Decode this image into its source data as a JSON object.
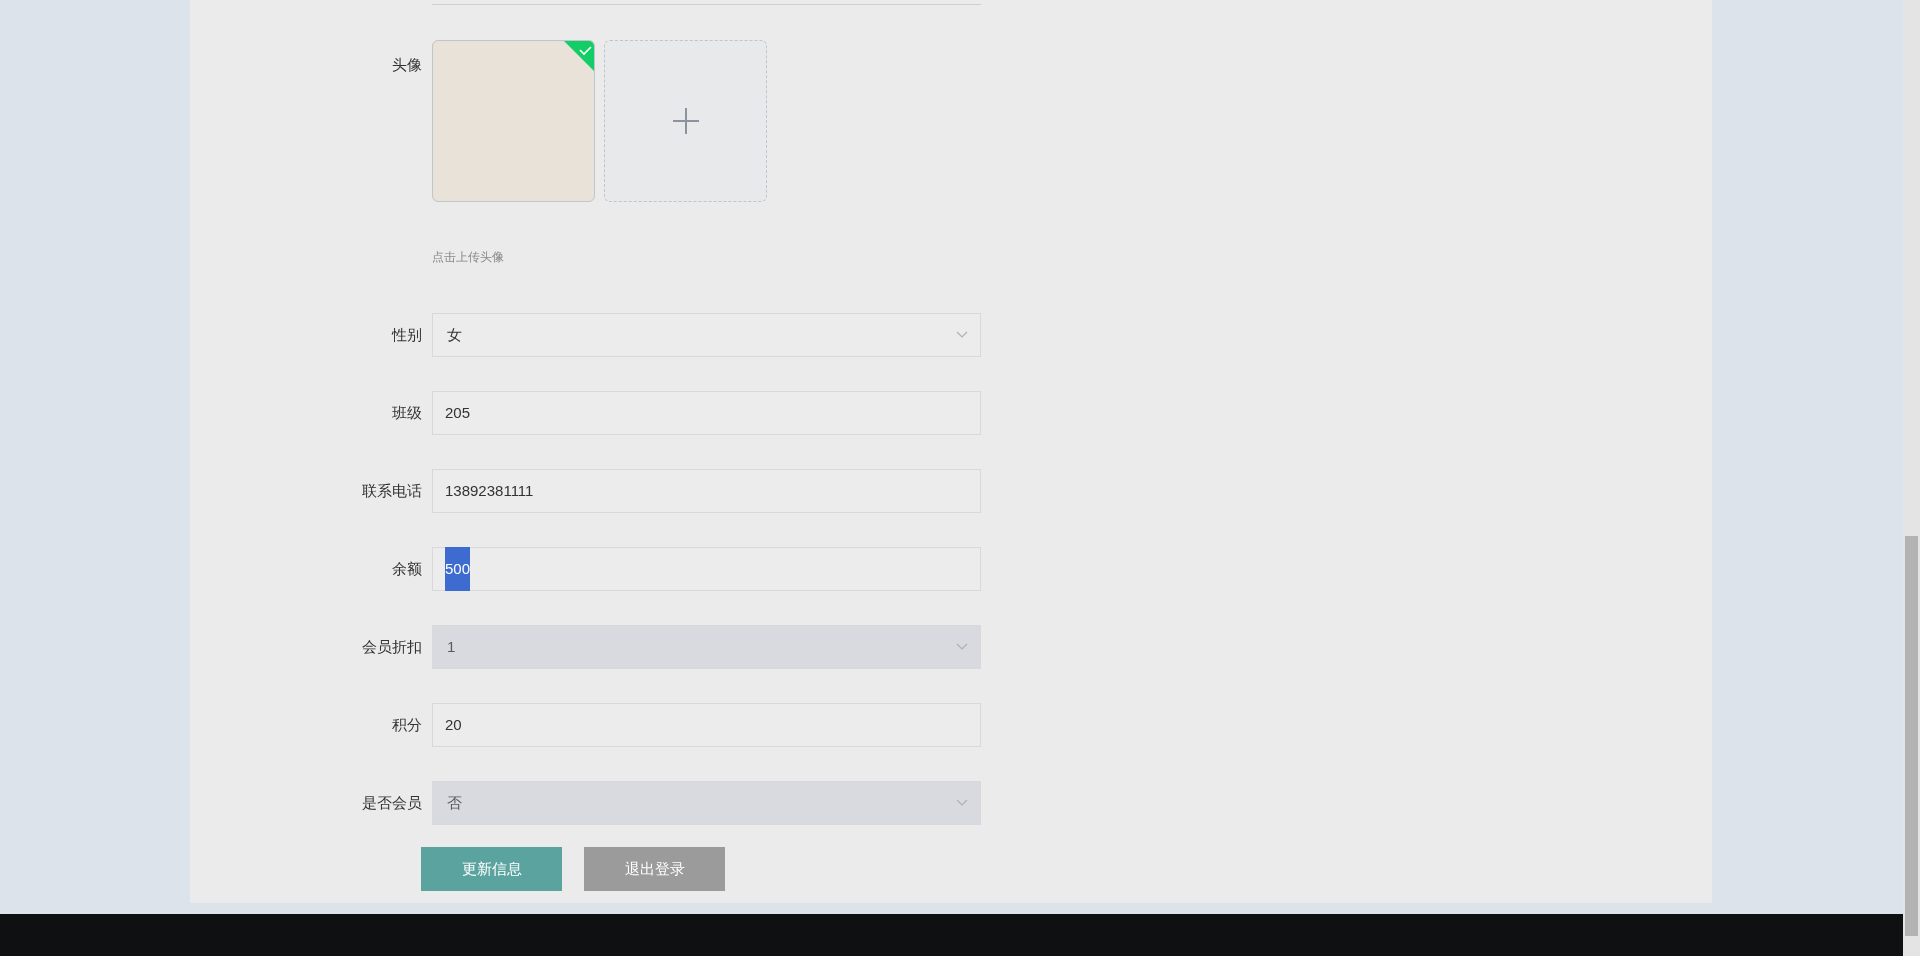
{
  "avatar": {
    "label": "头像",
    "uploaded": true,
    "hint": "点击上传头像"
  },
  "fields": [
    {
      "label": "性别",
      "kind": "select",
      "value": "女",
      "disabled": false,
      "highlighted": false
    },
    {
      "label": "班级",
      "kind": "text",
      "value": "205",
      "disabled": false,
      "highlighted": false
    },
    {
      "label": "联系电话",
      "kind": "text",
      "value": "13892381111",
      "disabled": false,
      "highlighted": false
    },
    {
      "label": "余额",
      "kind": "text",
      "value": "500",
      "disabled": false,
      "highlighted": true
    },
    {
      "label": "会员折扣",
      "kind": "select",
      "value": "1",
      "disabled": true,
      "highlighted": false
    },
    {
      "label": "积分",
      "kind": "text",
      "value": "20",
      "disabled": false,
      "highlighted": false
    },
    {
      "label": "是否会员",
      "kind": "select",
      "value": "否",
      "disabled": true,
      "highlighted": false
    }
  ],
  "buttons": [
    {
      "label": "更新信息",
      "kind": "primary"
    },
    {
      "label": "退出登录",
      "kind": "secondary"
    }
  ]
}
